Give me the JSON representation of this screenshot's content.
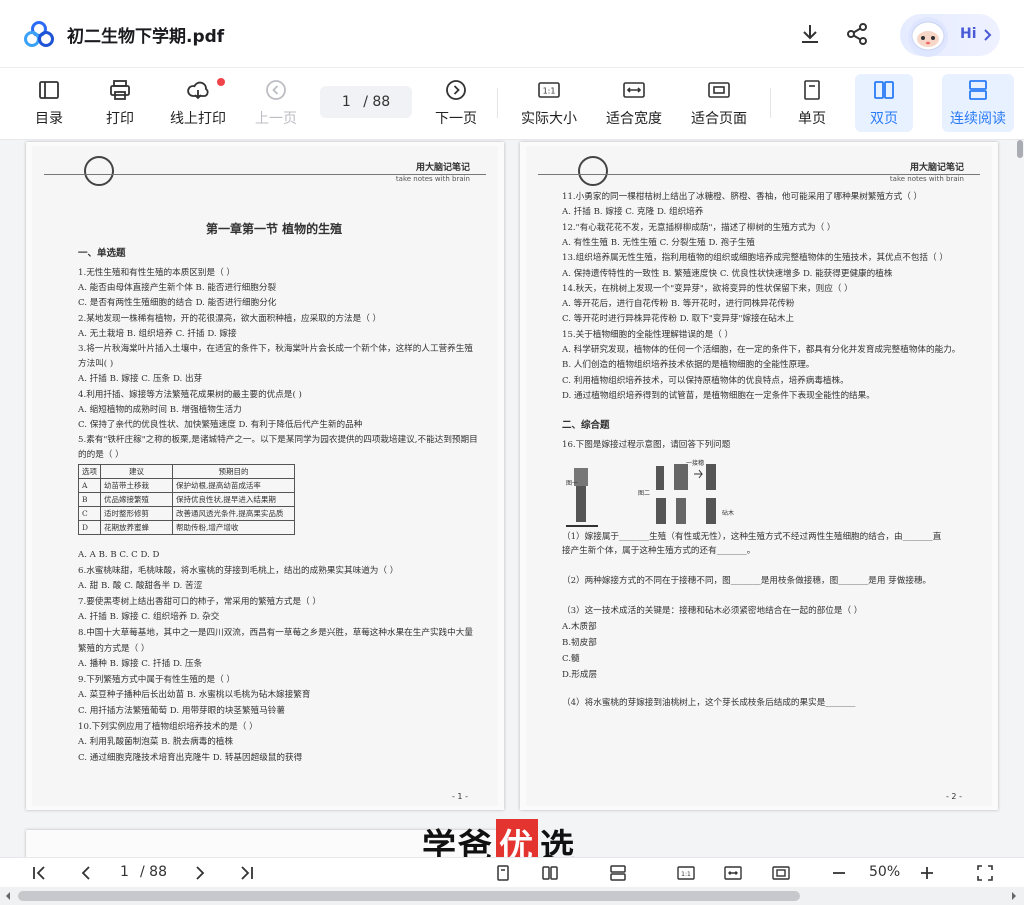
{
  "titlebar": {
    "title": "初二生物下学期.pdf",
    "greeting": "Hi"
  },
  "toolbar": {
    "items": [
      {
        "label": "目录",
        "icon": "outline-icon"
      },
      {
        "label": "打印",
        "icon": "printer-icon"
      },
      {
        "label": "线上打印",
        "icon": "cloud-print-icon"
      },
      {
        "label": "上一页",
        "icon": "prev-page-icon"
      },
      {
        "label": "下一页",
        "icon": "next-page-icon"
      },
      {
        "label": "实际大小",
        "icon": "actual-size-icon"
      },
      {
        "label": "适合宽度",
        "icon": "fit-width-icon"
      },
      {
        "label": "适合页面",
        "icon": "fit-page-icon"
      },
      {
        "label": "单页",
        "icon": "single-page-icon"
      },
      {
        "label": "双页",
        "icon": "double-page-icon"
      },
      {
        "label": "连续阅读",
        "icon": "continuous-icon"
      }
    ],
    "page_current": "1",
    "page_total": "/ 88",
    "accent": "#2a7bf6"
  },
  "page1": {
    "brand": "用大脑记笔记",
    "brand_en": "take notes with brain",
    "title": "第一章第一节 植物的生殖",
    "section": "一、单选题",
    "lines": [
      "1.无性生殖和有性生殖的本质区别是（    ）",
      "A. 能否由母体直接产生新个体                          B. 能否进行细胞分裂",
      "C. 是否有两性生殖细胞的结合                          D. 能否进行细胞分化",
      "2.某地发现一株稀有植物，开的花很漂亮，欲大面积种植，应采取的方法是（    ）",
      "A. 无土栽培                  B. 组织培养                  C. 扦插                  D. 嫁接",
      "3.将一片秋海棠叶片插入土壤中，在适宜的条件下，秋海棠叶片会长成一个新个体，这样的人工营养生殖",
      "方法叫(    )",
      "A. 扦插                  B. 嫁接                  C. 压条                  D. 出芽",
      "4.利用扦插、嫁接等方法繁殖花成果树的最主要的优点是(    )",
      "A. 缩短植物的成熟时间                          B. 增强植物生活力",
      "C. 保持了亲代的优良性状、加快繁殖速度                          D. 有利于降低后代产生新的品种",
      "5.素有\"铁杆庄稼\"之称的板栗,是诸城特产之一。以下是某同学为园农提供的四项栽培建议,不能达到预期目",
      "的的是（    ）"
    ],
    "table": {
      "headers": [
        "选项",
        "建议",
        "预期目的"
      ],
      "rows": [
        [
          "A",
          "幼苗带土移栽",
          "保护幼根,提高幼苗成活率"
        ],
        [
          "B",
          "优品嫁接繁殖",
          "保持优良性状,提早进入结果期"
        ],
        [
          "C",
          "适时整形修剪",
          "改善通风透光条件,提高果实品质"
        ],
        [
          "D",
          "花期放养蜜蜂",
          "帮助传粉,增产增收"
        ]
      ]
    },
    "lines2": [
      "A. A                              B. B                              C. C                              D. D",
      "6.水蜜桃味甜，毛桃味酸，将水蜜桃的芽接到毛桃上，结出的成熟果实其味道为（    ）",
      "A. 甜                    B. 酸                    C. 酸甜各半                    D. 苦涩",
      "7.要使黑枣树上结出香甜可口的柿子，常采用的繁殖方式是（    ）",
      "A. 扦插                    B. 嫁接                    C. 组织培养                    D. 杂交",
      "8.中国十大草莓基地，其中之一是四川双流，西昌有一草莓之乡是兴胜，草莓这种水果在生产实践中大量",
      "繁殖的方式是（    ）",
      "A. 播种                    B. 嫁接                    C. 扦插                    D. 压条",
      "9.下列繁殖方式中属于有性生殖的是（    ）",
      "A. 菜豆种子播种后长出幼苗                    B. 水蜜桃以毛桃为砧木嫁接繁育",
      "C. 用扦插方法繁殖葡萄                    D. 用带芽眼的块茎繁殖马铃薯",
      "10.下列实例应用了植物组织培养技术的是（    ）",
      "A. 利用乳酸菌制泡菜                    B. 脱去病毒的植株",
      "C. 通过细胞克隆技术培育出克隆牛                    D. 转基因超级鼠的获得"
    ],
    "page_number": "- 1 -"
  },
  "page2": {
    "brand": "用大脑记笔记",
    "brand_en": "take notes with brain",
    "lines": [
      "11.小勇家的同一棵柑桔树上结出了冰糖橙、脐橙、香柚，他可能采用了哪种果树繁殖方式（    ）",
      "A. 扦插                    B. 嫁接                    C. 克隆                    D. 组织培养",
      "12.\"有心栽花花不发，无意插柳柳成荫\"，描述了柳树的生殖方式为（    ）",
      "A. 有性生殖                    B. 无性生殖                    C. 分裂生殖                    D. 孢子生殖",
      "13.组织培养属无性生殖，指利用植物的组织或细胞培养成完整植物体的生殖技术，其优点不包括（    ）",
      "A. 保持遗传特性的一致性          B. 繁殖速度快          C. 优良性状快速增多          D. 能获得更健康的植株",
      "14.秋天，在桃树上发现一个\"变异芽\"，欲将变异的性状保留下来，则应（    ）",
      "A. 等开花后，进行自花传粉                              B. 等开花时，进行同株异花传粉",
      "C. 等开花时进行异株异花传粉                              D. 取下\"变异芽\"嫁接在砧木上",
      "15.关于植物细胞的全能性理解错误的是（    ）",
      "A. 科学研究发现，植物体的任何一个活细胞，在一定的条件下，都具有分化并发育成完整植物体的能力。",
      "B. 人们创造的植物组织培养技术依据的是植物细胞的全能性原理。",
      "C. 利用植物组织培养技术，可以保持原植物体的优良特点，培养病毒植株。",
      "D. 通过植物组织培养得到的试管苗，是植物细胞在一定条件下表现全能性的结果。"
    ],
    "section": "二、综合题",
    "q16": "16.下图是嫁接过程示意图，请回答下列问题",
    "fig_labels": [
      "一接穗",
      "图一",
      "图二",
      "砧木"
    ],
    "lines2": [
      "（1）嫁接属于_______生殖（有性或无性），这种生殖方式不经过两性生殖细胞的结合，由_______直",
      "接产生新个体，属于这种生殖方式的还有_______。",
      "（2）两种嫁接方式的不同在于接穗不同，图_______是用枝条做接穗，图_______是用 芽做接穗。",
      "（3）这一技术成活的关键是：接穗和砧木必须紧密地结合在一起的部位是（    ）",
      "A.木质部",
      "B.韧皮部",
      "C.髓",
      "D.形成层",
      "（4）将水蜜桃的芽嫁接到油桃树上，这个芽长成枝条后结成的果实是_______"
    ],
    "page_number": "- 2 -"
  },
  "watermark": {
    "part1": "学爸",
    "part2": "优",
    "part3": "选"
  },
  "bottombar": {
    "page_current": "1",
    "page_total": "/ 88",
    "zoom": "50%"
  }
}
